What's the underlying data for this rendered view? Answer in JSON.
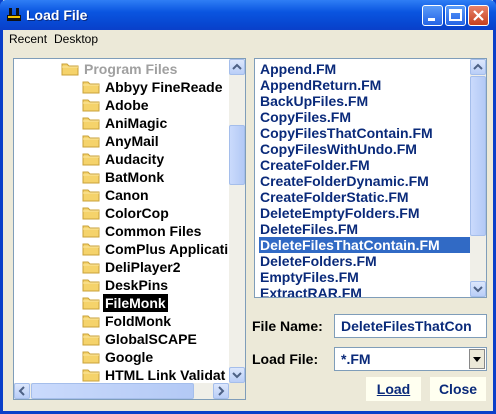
{
  "window": {
    "title": "Load File"
  },
  "menu": [
    "Recent",
    "Desktop"
  ],
  "tree": {
    "parent": "Program Files",
    "folders": [
      "Abbyy FineReade",
      "Adobe",
      "AniMagic",
      "AnyMail",
      "Audacity",
      "BatMonk",
      "Canon",
      "ColorCop",
      "Common Files",
      "ComPlus Applicati",
      "DeliPlayer2",
      "DeskPins",
      "FileMonk",
      "FoldMonk",
      "GlobalSCAPE",
      "Google",
      "HTML Link Validat"
    ],
    "selected": "FileMonk"
  },
  "files": {
    "items": [
      "Append.FM",
      "AppendReturn.FM",
      "BackUpFiles.FM",
      "CopyFiles.FM",
      "CopyFilesThatContain.FM",
      "CopyFilesWithUndo.FM",
      "CreateFolder.FM",
      "CreateFolderDynamic.FM",
      "CreateFolderStatic.FM",
      "DeleteEmptyFolders.FM",
      "DeleteFiles.FM",
      "DeleteFilesThatContain.FM",
      "DeleteFolders.FM",
      "EmptyFiles.FM",
      "ExtractRAR.FM"
    ],
    "selected": "DeleteFilesThatContain.FM"
  },
  "form": {
    "file_name_label": "File Name:",
    "file_name_value": "DeleteFilesThatCon",
    "load_file_label": "Load File:",
    "load_file_value": "*.FM"
  },
  "buttons": {
    "load": "Load",
    "close": "Close"
  },
  "colors": {
    "title_bar": "#0A55E0",
    "selection": "#316AC5",
    "dialog_bg": "#ECE9D8"
  }
}
